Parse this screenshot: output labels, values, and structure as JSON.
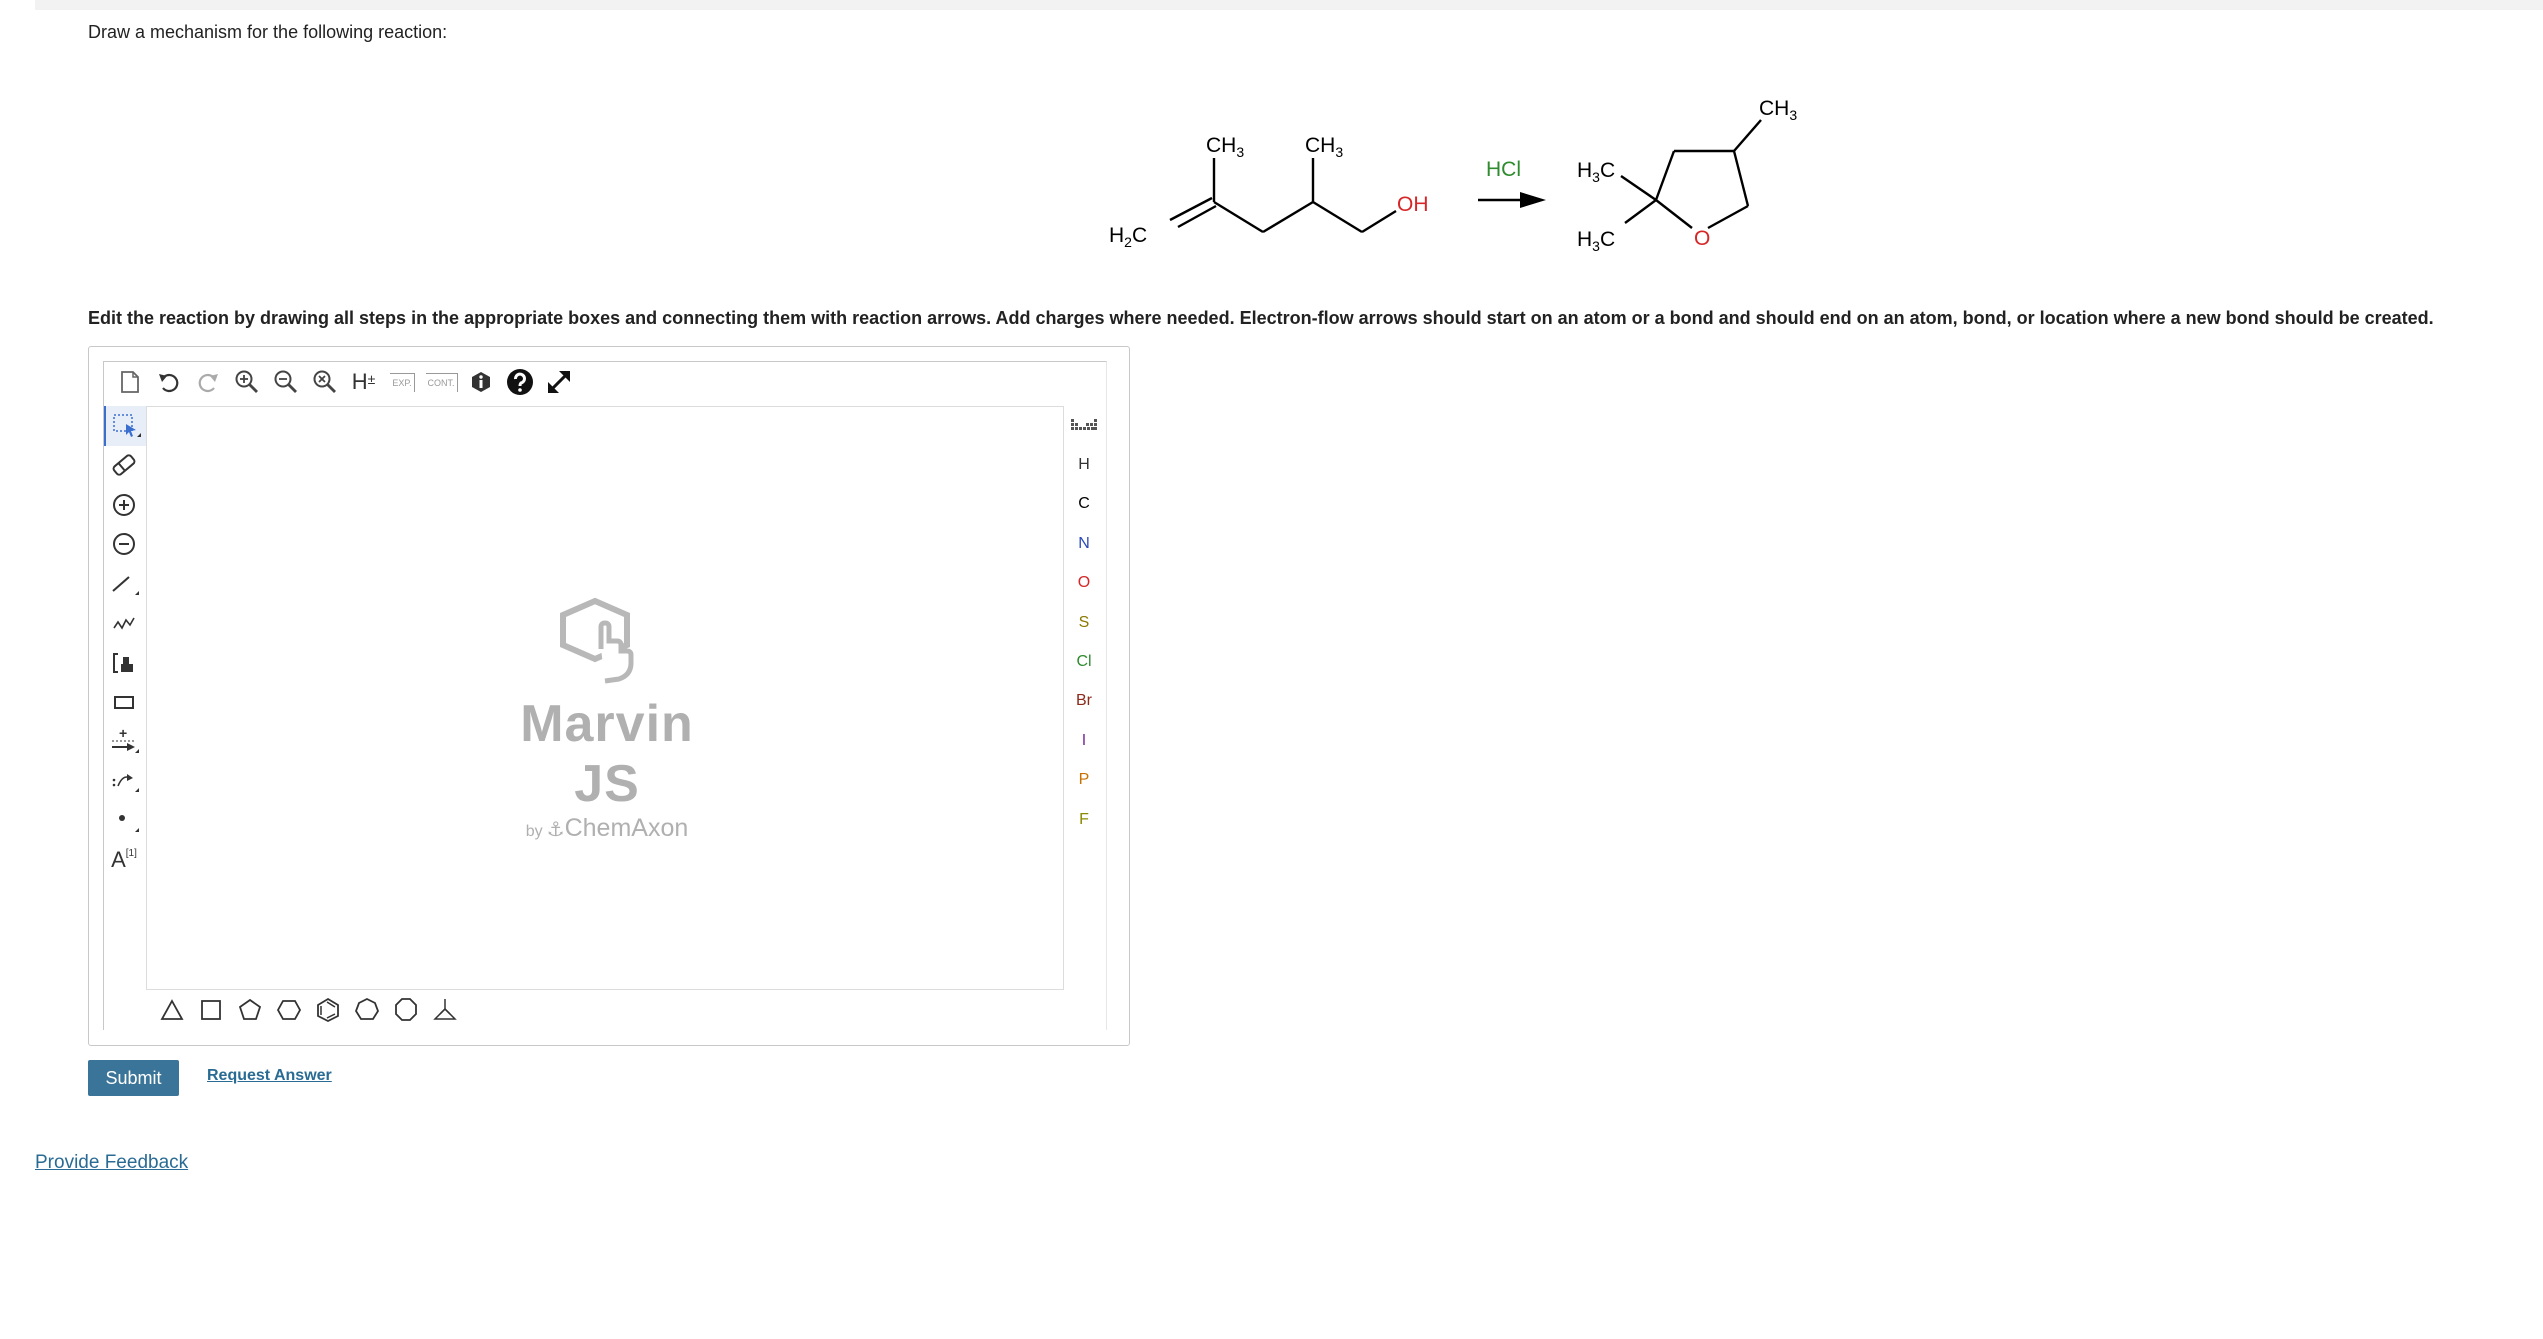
{
  "question": {
    "prompt": "Draw a mechanism for the following reaction:",
    "instructions": "Edit the reaction by drawing all steps in the appropriate boxes and connecting them with reaction arrows. Add charges where needed. Electron-flow arrows should start on an atom or a bond and should end on an atom, bond, or location where a new bond should be created."
  },
  "reaction": {
    "reactant_labels": {
      "ch3_a": "CH",
      "ch3_a_sub": "3",
      "ch3_b": "CH",
      "ch3_b_sub": "3",
      "h2c": "H",
      "h2c_sub": "2",
      "h2c_tail": "C",
      "oh": "OH"
    },
    "reagent": "HCl",
    "product_labels": {
      "ch3": "CH",
      "ch3_sub": "3",
      "h3c_a": "H",
      "h3c_a_sub": "3",
      "h3c_a_tail": "C",
      "h3c_b": "H",
      "h3c_b_sub": "3",
      "h3c_b_tail": "C",
      "o": "O"
    },
    "colors": {
      "bond": "#000000",
      "oxygen": "#d62728",
      "reagent": "#2e8b2e"
    }
  },
  "editor": {
    "top_toolbar": {
      "h_label": "H",
      "h_sign": "±",
      "exp_label": "EXP.",
      "cont_label": "CONT."
    },
    "left_toolbar": {
      "text_tool": "A",
      "text_tool_sup": "[1]",
      "charge_plus": "+"
    },
    "elements": [
      {
        "symbol": "H",
        "color": "#333333"
      },
      {
        "symbol": "C",
        "color": "#000000"
      },
      {
        "symbol": "N",
        "color": "#2b4ab8"
      },
      {
        "symbol": "O",
        "color": "#d62728"
      },
      {
        "symbol": "S",
        "color": "#8a7a00"
      },
      {
        "symbol": "Cl",
        "color": "#2e8b2e"
      },
      {
        "symbol": "Br",
        "color": "#8b2a1a"
      },
      {
        "symbol": "I",
        "color": "#7a2a9a"
      },
      {
        "symbol": "P",
        "color": "#c87000"
      },
      {
        "symbol": "F",
        "color": "#8a8a00"
      }
    ],
    "watermark": {
      "title": "Marvin JS",
      "by": "by",
      "company": "ChemAxon"
    }
  },
  "buttons": {
    "submit": "Submit",
    "request_answer": "Request Answer",
    "provide_feedback": "Provide Feedback"
  }
}
